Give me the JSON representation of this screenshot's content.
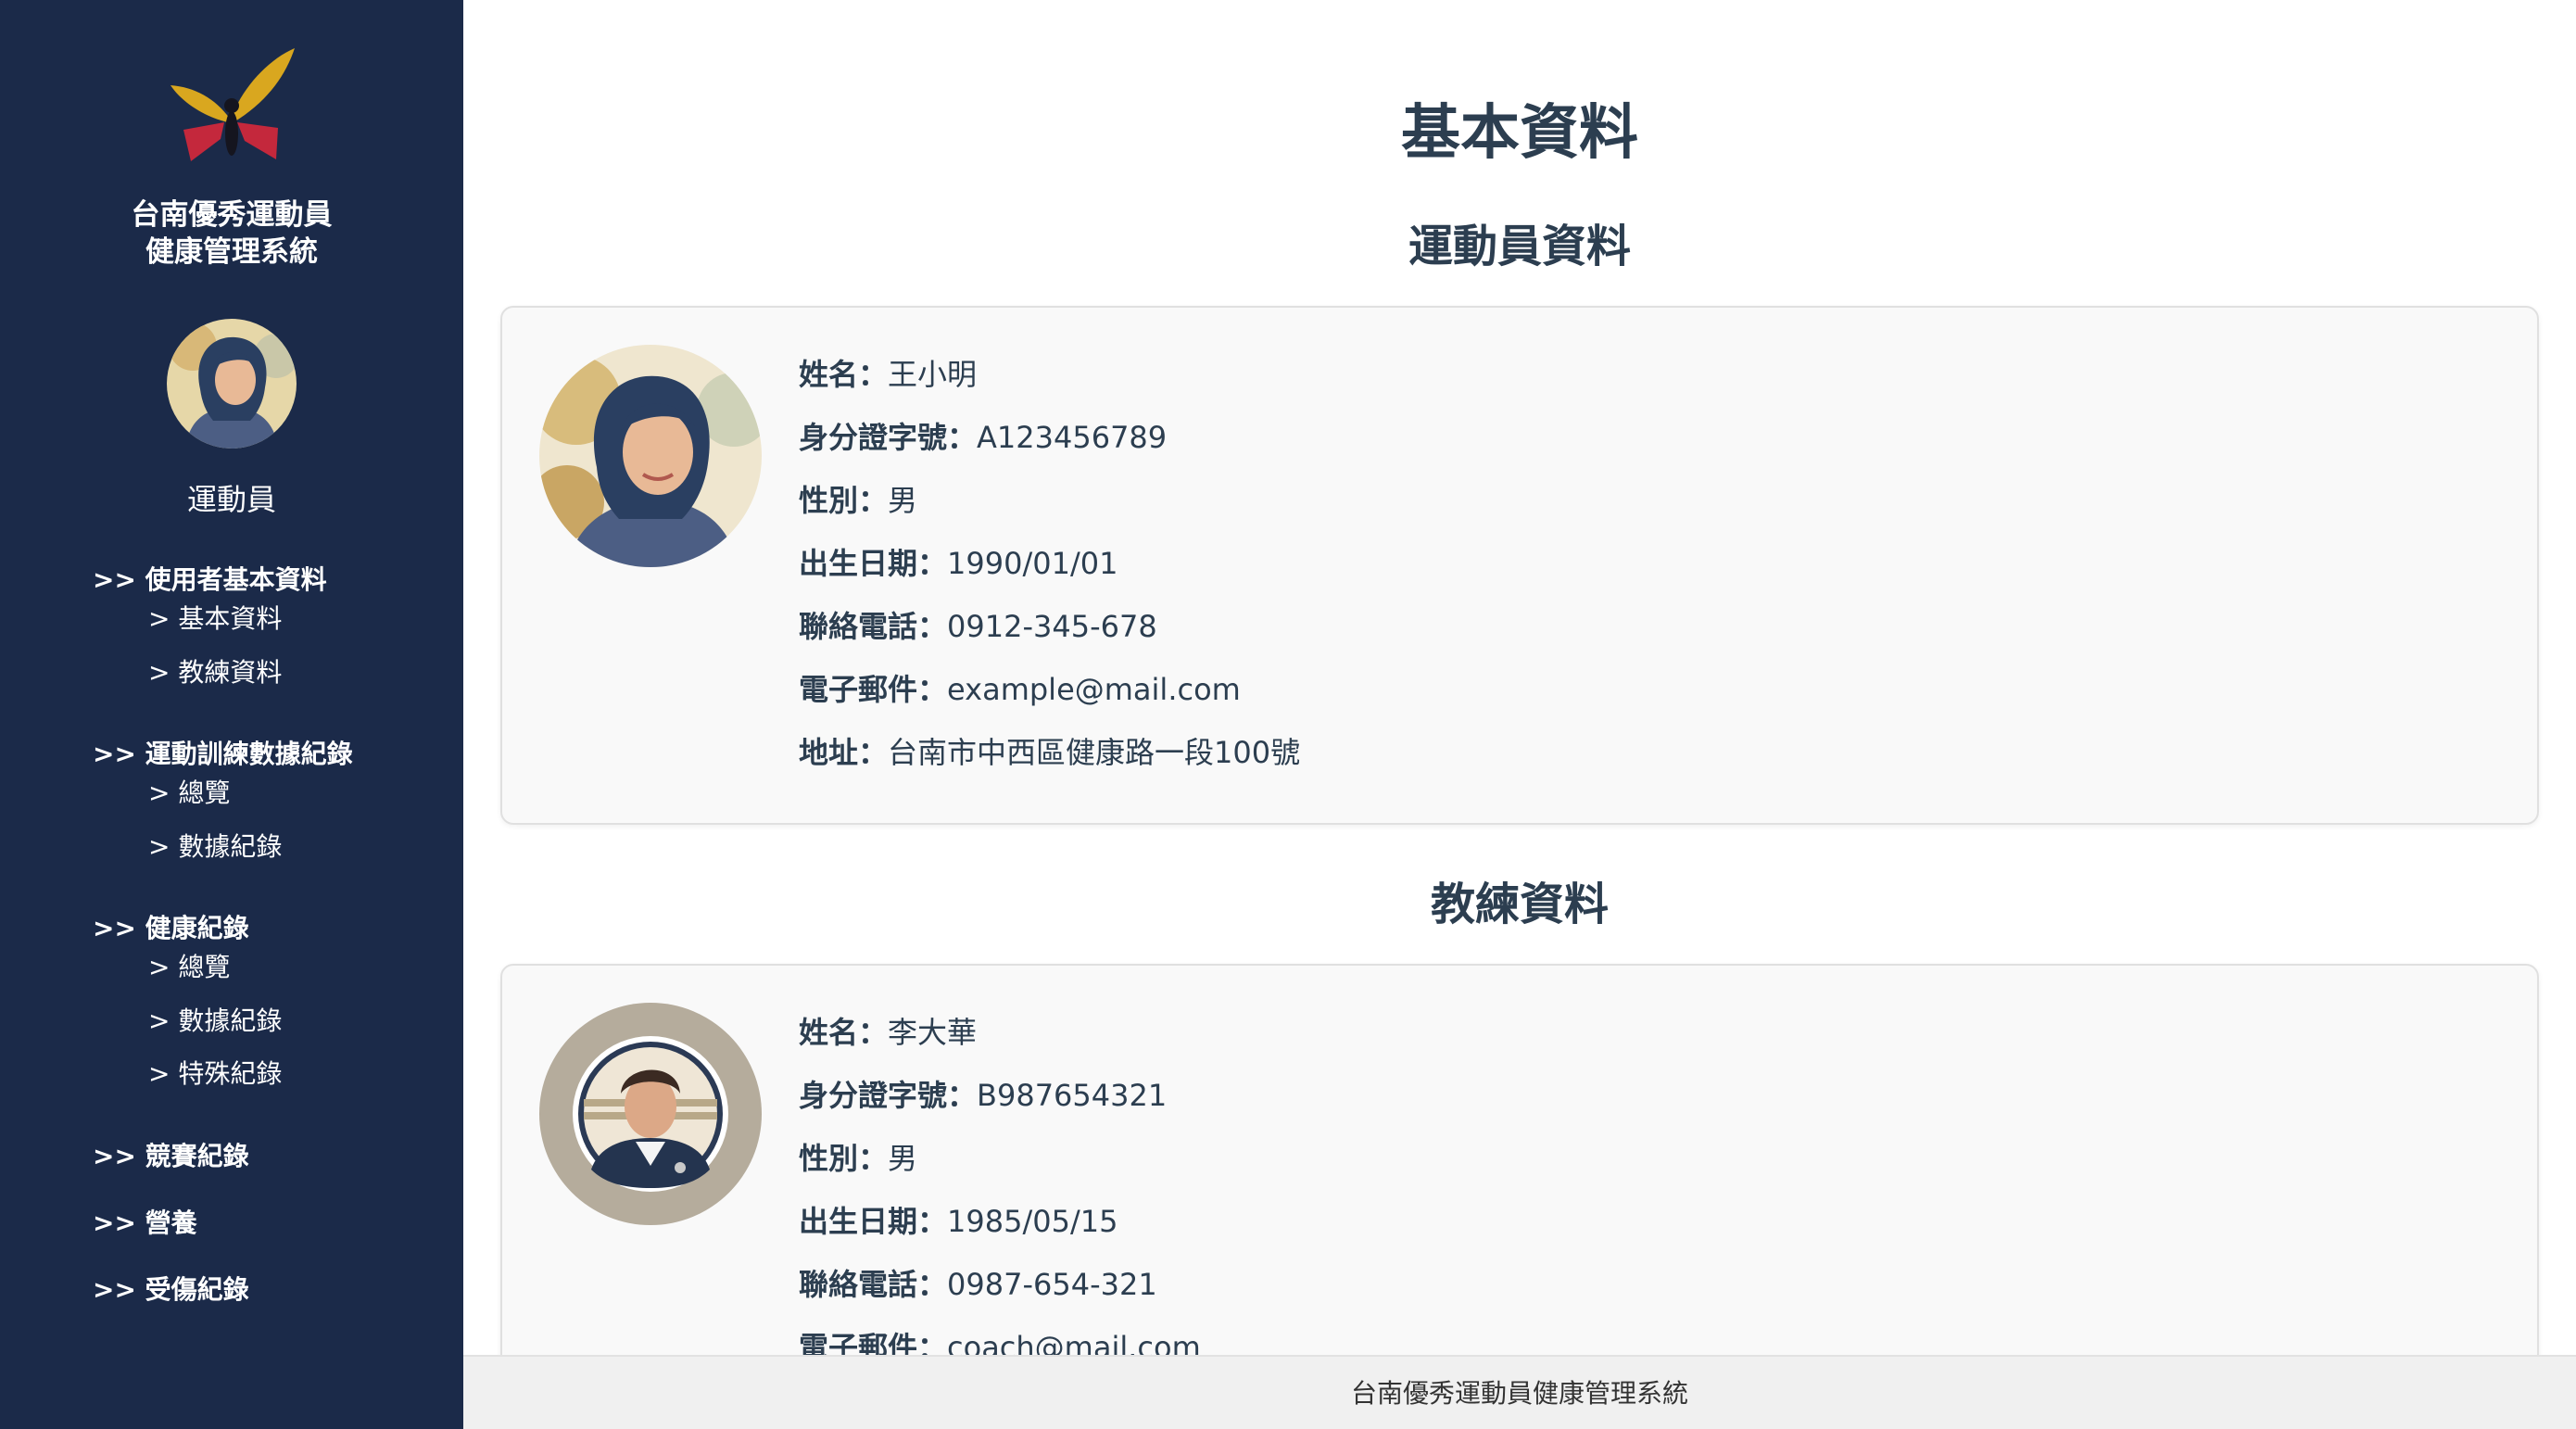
{
  "sidebar": {
    "logo_icon": "butterfly-logo",
    "title_line1": "台南優秀運動員",
    "title_line2": "健康管理系統",
    "role": "運動員",
    "menu": {
      "user": {
        "label": ">> 使用者基本資料",
        "sub1": "> 基本資料",
        "sub2": "> 教練資料"
      },
      "training": {
        "label": ">> 運動訓練數據紀錄",
        "sub1": "> 總覽",
        "sub2": "> 數據紀錄"
      },
      "health": {
        "label": ">> 健康紀錄",
        "sub1": "> 總覽",
        "sub2": "> 數據紀錄",
        "sub3": "> 特殊紀錄"
      },
      "competition": {
        "label": ">> 競賽紀錄"
      },
      "nutrition": {
        "label": ">> 營養"
      },
      "injury": {
        "label": ">> 受傷紀錄"
      }
    }
  },
  "main": {
    "page_title": "基本資料",
    "athlete": {
      "section_title": "運動員資料",
      "name_label": "姓名：",
      "name": "王小明",
      "id_label": "身分證字號：",
      "id": "A123456789",
      "gender_label": "性別：",
      "gender": "男",
      "dob_label": "出生日期：",
      "dob": "1990/01/01",
      "phone_label": "聯絡電話：",
      "phone": "0912-345-678",
      "email_label": "電子郵件：",
      "email": "example@mail.com",
      "address_label": "地址：",
      "address": "台南市中西區健康路一段100號"
    },
    "coach": {
      "section_title": "教練資料",
      "name_label": "姓名：",
      "name": "李大華",
      "id_label": "身分證字號：",
      "id": "B987654321",
      "gender_label": "性別：",
      "gender": "男",
      "dob_label": "出生日期：",
      "dob": "1985/05/15",
      "phone_label": "聯絡電話：",
      "phone": "0987-654-321",
      "email_label": "電子郵件：",
      "email": "coach@mail.com"
    }
  },
  "footer": {
    "text": "台南優秀運動員健康管理系統"
  },
  "colors": {
    "sidebar_bg": "#1b2a49",
    "text_dark": "#2c3e50",
    "card_bg": "#f9f9f9",
    "footer_bg": "#f0f0f0"
  }
}
